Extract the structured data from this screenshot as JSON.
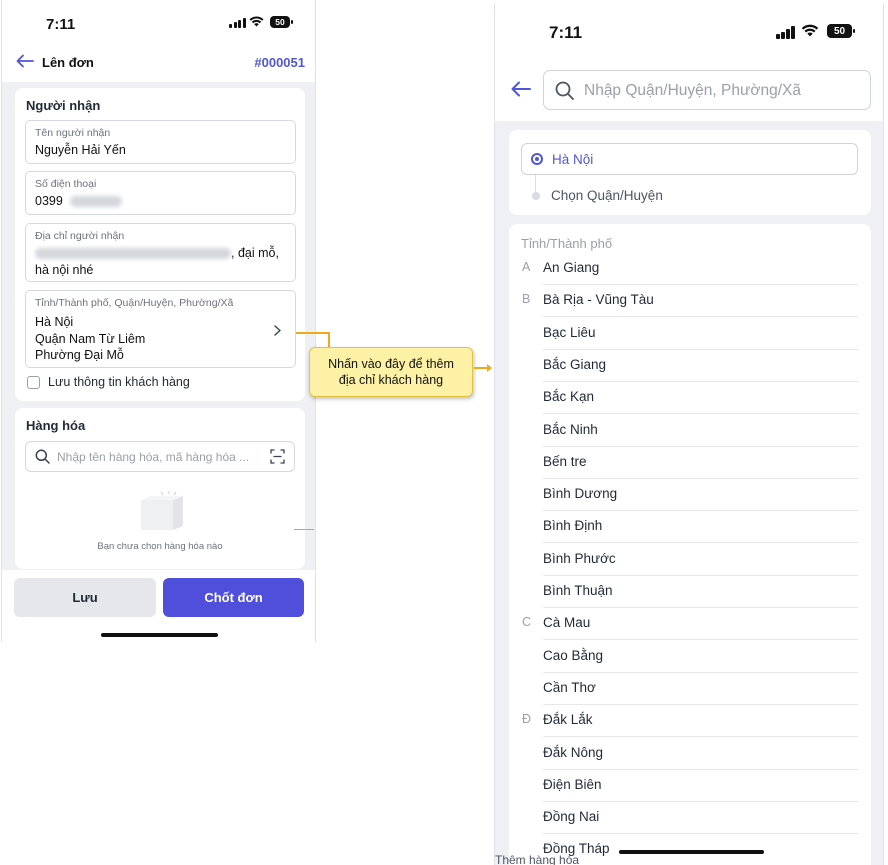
{
  "left_screen": {
    "status_time": "7:11",
    "battery": "50",
    "nav": {
      "title": "Lên đơn",
      "order_code": "#000051"
    },
    "recipient": {
      "section_title": "Người nhận",
      "name_label": "Tên người nhận",
      "name_value": "Nguyễn Hải Yến",
      "phone_label": "Số điện thoại",
      "phone_value": "0399",
      "address_label": "Địa chỉ người nhận",
      "address_line1_suffix": ", đại mỗ,",
      "address_line2": "hà nội nhé",
      "region_label": "Tỉnh/Thành phố, Quận/Huyện, Phường/Xã",
      "region_province": "Hà Nội",
      "region_district": "Quận Nam Từ Liêm",
      "region_ward": "Phường Đại Mỗ",
      "save_info_label": "Lưu thông tin khách hàng"
    },
    "goods": {
      "section_title": "Hàng hóa",
      "search_placeholder": "Nhập tên hàng hóa, mã hàng hóa ...",
      "empty_text": "Bạn chưa chọn hàng hóa nào"
    },
    "buttons": {
      "save": "Lưu",
      "finalize": "Chốt đơn"
    }
  },
  "callout": {
    "line1": "Nhấn vào đây để thêm",
    "line2": "địa chỉ khách hàng"
  },
  "right_screen": {
    "status_time": "7:11",
    "battery": "50",
    "search_placeholder": "Nhập Quận/Huyện, Phường/Xã",
    "path": {
      "selected": "Hà Nội",
      "next": "Chọn Quận/Huyện"
    },
    "list_header": "Tỉnh/Thành phố",
    "provinces": [
      {
        "letter": "A",
        "name": "An Giang"
      },
      {
        "letter": "B",
        "name": "Bà Rịa - Vũng Tàu"
      },
      {
        "letter": "",
        "name": "Bạc Liêu"
      },
      {
        "letter": "",
        "name": "Bắc Giang"
      },
      {
        "letter": "",
        "name": "Bắc Kạn"
      },
      {
        "letter": "",
        "name": "Bắc Ninh"
      },
      {
        "letter": "",
        "name": "Bến tre"
      },
      {
        "letter": "",
        "name": "Bình Dương"
      },
      {
        "letter": "",
        "name": "Bình Định"
      },
      {
        "letter": "",
        "name": "Bình Phước"
      },
      {
        "letter": "",
        "name": "Bình Thuận"
      },
      {
        "letter": "C",
        "name": "Cà Mau"
      },
      {
        "letter": "",
        "name": "Cao Bằng"
      },
      {
        "letter": "",
        "name": "Cần Thơ"
      },
      {
        "letter": "Đ",
        "name": "Đắk Lắk"
      },
      {
        "letter": "",
        "name": "Đắk Nông"
      },
      {
        "letter": "",
        "name": "Điện Biên"
      },
      {
        "letter": "",
        "name": "Đồng Nai"
      },
      {
        "letter": "",
        "name": "Đồng Tháp"
      }
    ],
    "overflow_text": "Thêm hàng hóa"
  },
  "colors": {
    "accent": "#4f56d9",
    "primary_button": "#4f4fdc",
    "callout_bg": "#fdf1a6",
    "callout_line": "#f0a81c"
  }
}
